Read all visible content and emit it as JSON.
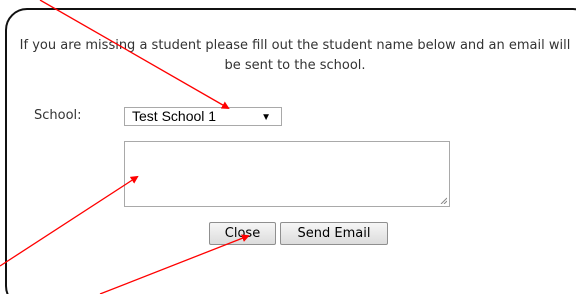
{
  "dialog": {
    "message": "If you are missing a student please fill out the student name below and an email will be sent to the school.",
    "school_label": "School:",
    "school_select": {
      "selected": "Test School 1"
    },
    "student_textarea": {
      "value": ""
    },
    "buttons": {
      "close": "Close",
      "send_email": "Send Email"
    }
  },
  "annotations": {
    "arrow_color": "#ff0000"
  }
}
